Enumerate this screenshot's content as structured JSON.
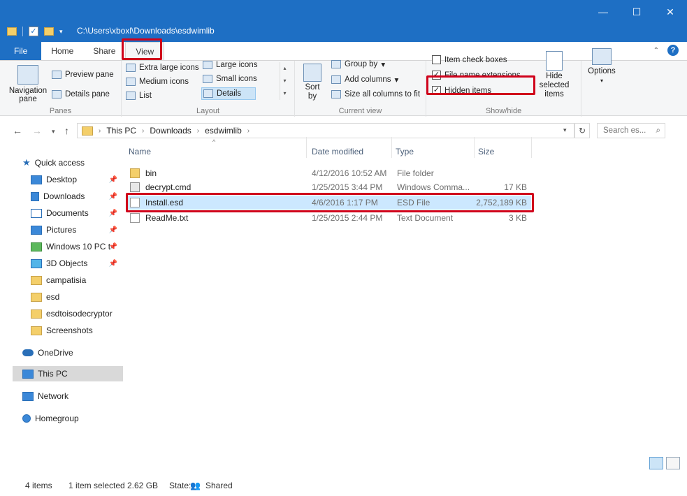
{
  "window": {
    "path": "C:\\Users\\xboxl\\Downloads\\esdwimlib",
    "controls": [
      "—",
      "☐",
      "✕"
    ]
  },
  "tabs": [
    "File",
    "Home",
    "Share",
    "View"
  ],
  "ribbon": {
    "panes": {
      "navigation_pane": "Navigation pane",
      "preview_pane": "Preview pane",
      "details_pane": "Details pane",
      "label": "Panes"
    },
    "layout": {
      "extra_large_icons": "Extra large icons",
      "large_icons": "Large icons",
      "medium_icons": "Medium icons",
      "small_icons": "Small icons",
      "list": "List",
      "details": "Details",
      "label": "Layout"
    },
    "current_view": {
      "sort_by": "Sort by",
      "group_by": "Group by",
      "add_columns": "Add columns",
      "size_all_columns": "Size all columns to fit",
      "label": "Current view"
    },
    "show_hide": {
      "item_check_boxes": "Item check boxes",
      "file_name_extensions": "File name extensions",
      "hidden_items": "Hidden items",
      "hide_selected_items": "Hide selected items",
      "label": "Show/hide",
      "checks": {
        "item_check_boxes": false,
        "file_name_extensions": true,
        "hidden_items": true
      }
    },
    "options": "Options"
  },
  "address": {
    "crumbs": [
      "This PC",
      "Downloads",
      "esdwimlib"
    ],
    "search_placeholder": "Search es..."
  },
  "nav": {
    "quick_access": "Quick access",
    "items": [
      {
        "label": "Desktop",
        "icon": "desktop-icon",
        "pinned": true
      },
      {
        "label": "Downloads",
        "icon": "downloads-icon",
        "pinned": true
      },
      {
        "label": "Documents",
        "icon": "documents-icon",
        "pinned": true
      },
      {
        "label": "Pictures",
        "icon": "pictures-icon",
        "pinned": true
      },
      {
        "label": "Windows 10 PC t",
        "icon": "windows-icon",
        "pinned": true
      },
      {
        "label": "3D Objects",
        "icon": "3d-objects-icon",
        "pinned": true
      },
      {
        "label": "campatisia",
        "icon": "folder-icon",
        "pinned": false
      },
      {
        "label": "esd",
        "icon": "folder-icon",
        "pinned": false
      },
      {
        "label": "esdtoisodecryptor",
        "icon": "folder-icon",
        "pinned": false
      },
      {
        "label": "Screenshots",
        "icon": "folder-icon",
        "pinned": false
      }
    ],
    "onedrive": "OneDrive",
    "this_pc": "This PC",
    "network": "Network",
    "homegroup": "Homegroup"
  },
  "columns": {
    "name": "Name",
    "date": "Date modified",
    "type": "Type",
    "size": "Size"
  },
  "files": [
    {
      "name": "bin",
      "date": "4/12/2016 10:52 AM",
      "type": "File folder",
      "size": "",
      "icon": "folder-icon"
    },
    {
      "name": "decrypt.cmd",
      "date": "1/25/2015 3:44 PM",
      "type": "Windows Comma...",
      "size": "17 KB",
      "icon": "cmd-file-icon"
    },
    {
      "name": "Install.esd",
      "date": "4/6/2016 1:17 PM",
      "type": "ESD File",
      "size": "2,752,189 KB",
      "icon": "file-icon"
    },
    {
      "name": "ReadMe.txt",
      "date": "1/25/2015 2:44 PM",
      "type": "Text Document",
      "size": "3 KB",
      "icon": "text-file-icon"
    }
  ],
  "status": {
    "count": "4 items",
    "selected": "1 item selected",
    "size": "2.62 GB",
    "state_label": "State:",
    "state_value": "Shared"
  },
  "colors": {
    "accent": "#1e6fc4",
    "highlight": "#d0021b",
    "selection": "#cce8ff"
  }
}
